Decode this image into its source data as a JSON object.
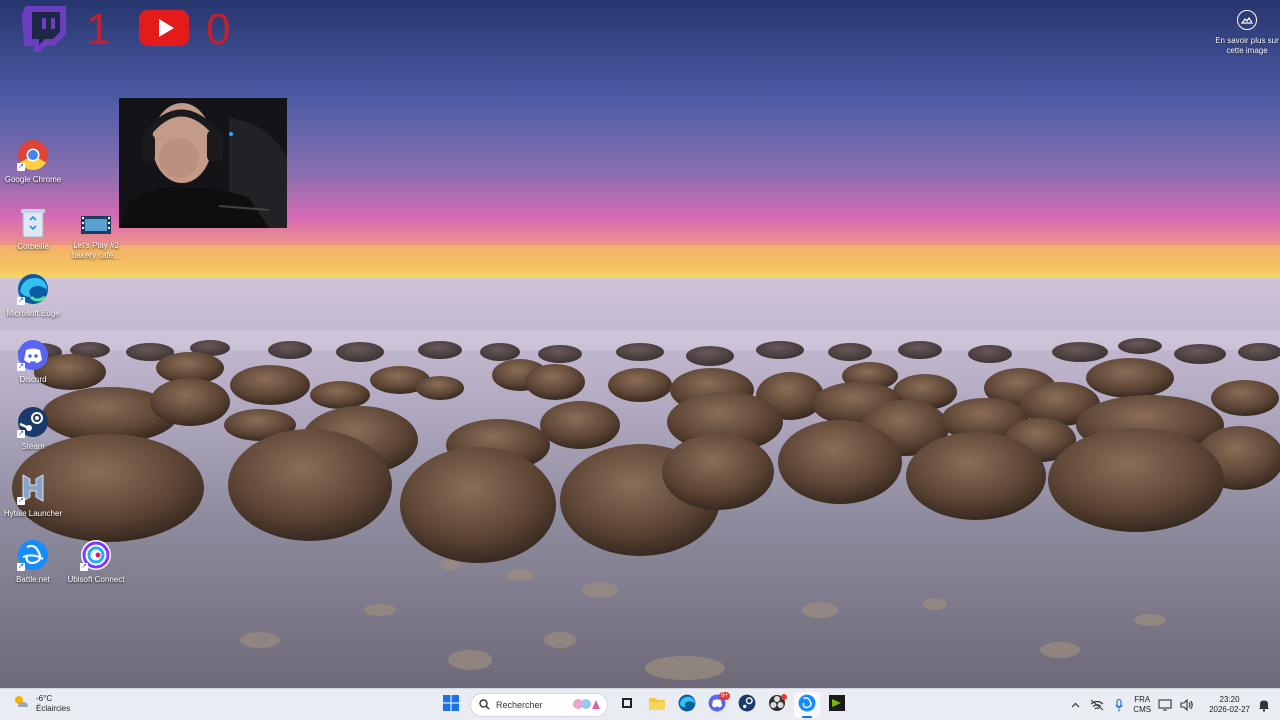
{
  "overlay": {
    "twitch_icon": "twitch-icon",
    "twitch_count": "1",
    "youtube_icon": "youtube-icon",
    "youtube_count": "0",
    "learn_more": "En savoir plus sur cette image",
    "accent_red": "#c8202a"
  },
  "desktop_icons": [
    {
      "label": "Google Chrome",
      "icon": "chrome-icon"
    },
    {
      "label": "Corbeille",
      "icon": "recycle-bin-icon"
    },
    {
      "label": "Let's Play #2 bakery cafe...",
      "icon": "video-file-icon"
    },
    {
      "label": "Microsoft Edge",
      "icon": "edge-icon"
    },
    {
      "label": "Discord",
      "icon": "discord-icon"
    },
    {
      "label": "Steam",
      "icon": "steam-icon"
    },
    {
      "label": "Hytale Launcher",
      "icon": "hytale-icon"
    },
    {
      "label": "Battle.net",
      "icon": "battlenet-icon"
    },
    {
      "label": "Ubisoft Connect",
      "icon": "ubisoft-icon"
    }
  ],
  "taskbar": {
    "weather_temp": "-6°C",
    "weather_desc": "Éclaircies",
    "search_placeholder": "Rechercher",
    "apps": [
      "start-icon",
      "task-view-icon",
      "file-explorer-icon",
      "edge-icon",
      "discord-icon",
      "steam-icon",
      "obs-icon",
      "battlenet-icon",
      "nvidia-icon"
    ],
    "discord_badge": "9+",
    "lang_top": "FRA",
    "lang_bottom": "CMS",
    "time": "23:20",
    "date": "2026-02-27"
  }
}
